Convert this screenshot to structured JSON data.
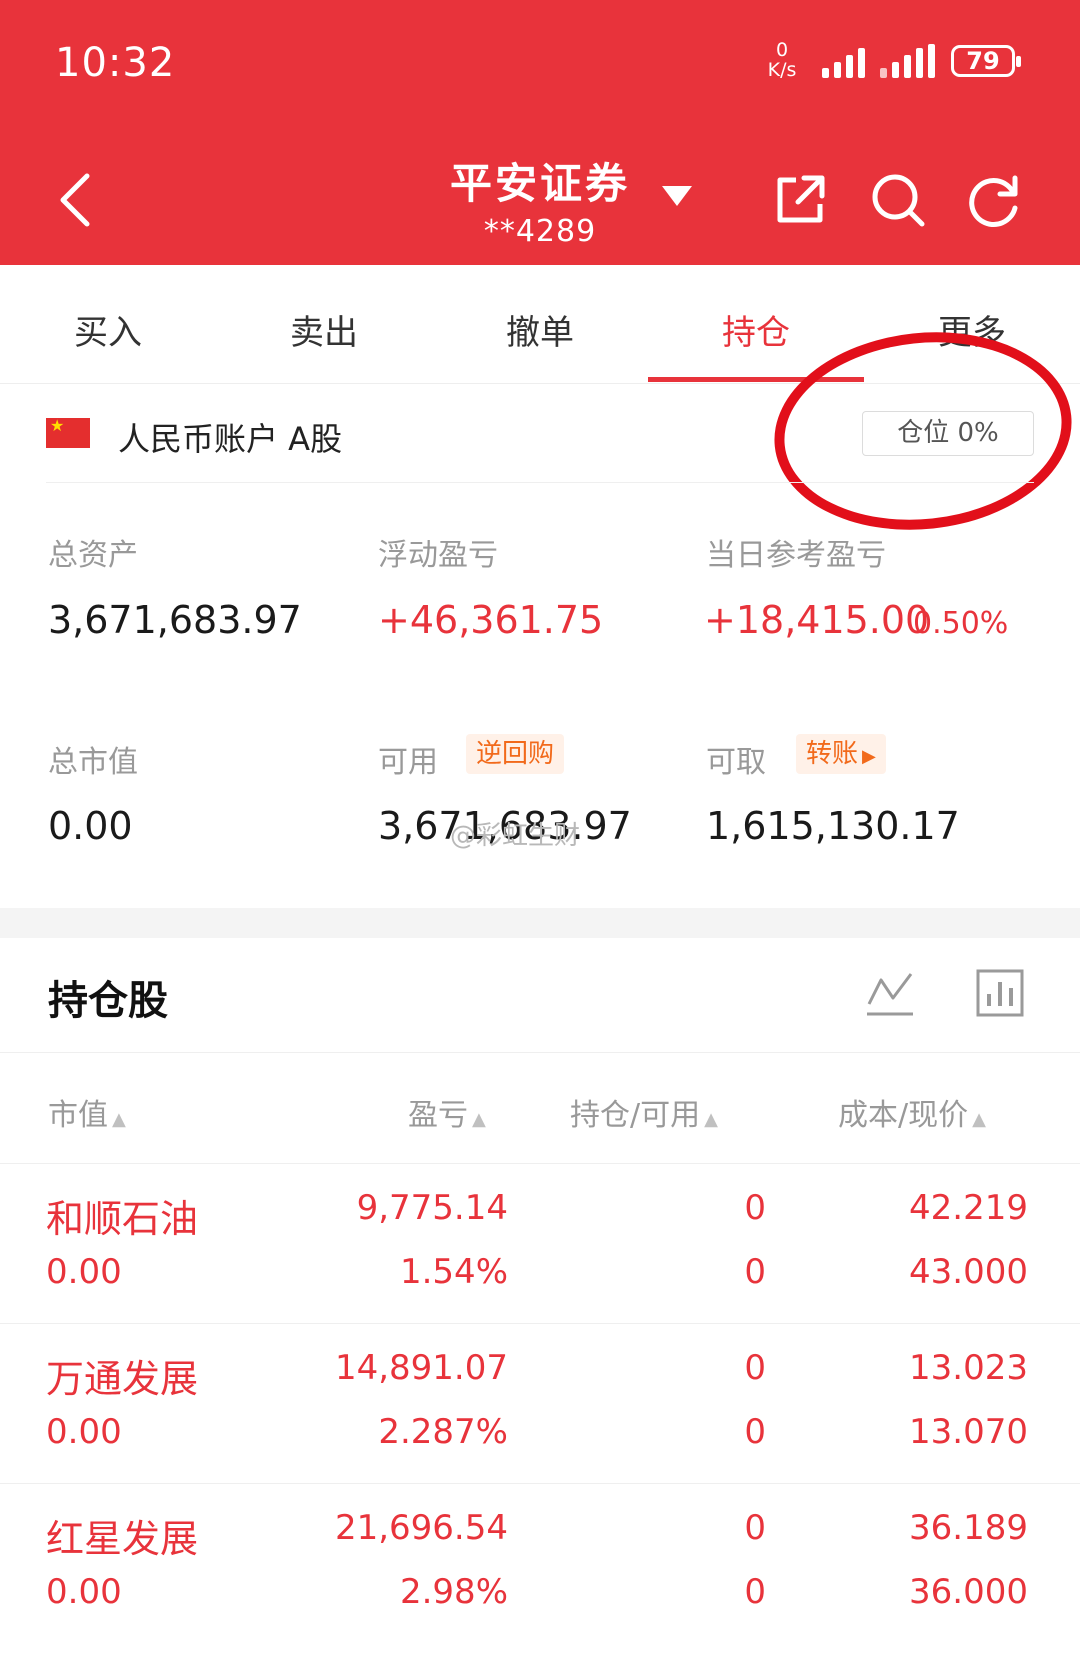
{
  "status_bar": {
    "time": "10:32",
    "net_speed_value": "0",
    "net_speed_unit": "K/s",
    "battery": "79"
  },
  "header": {
    "broker": "平安证券",
    "account": "**4289",
    "icons": [
      "back-icon",
      "dropdown-icon",
      "share-icon",
      "search-icon",
      "refresh-icon"
    ]
  },
  "tabs": [
    "买入",
    "卖出",
    "撤单",
    "持仓",
    "更多"
  ],
  "active_tab": 3,
  "account": {
    "name": "人民币账户 A股",
    "position_label": "仓位 0%"
  },
  "summary": {
    "total_assets": {
      "label": "总资产",
      "value": "3,671,683.97"
    },
    "floating_pl": {
      "label": "浮动盈亏",
      "value": "+46,361.75"
    },
    "today_pl": {
      "label": "当日参考盈亏",
      "value": "+18,415.00",
      "pct": "0.50%"
    },
    "market_value": {
      "label": "总市值",
      "value": "0.00"
    },
    "available": {
      "label": "可用",
      "tag": "逆回购",
      "value": "3,671,683.97"
    },
    "withdrawable": {
      "label": "可取",
      "tag": "转账",
      "value": "1,615,130.17"
    },
    "watermark": "@彩虹生财"
  },
  "holdings": {
    "title": "持仓股",
    "columns": [
      "市值",
      "盈亏",
      "持仓/可用",
      "成本/现价"
    ],
    "rows": [
      {
        "name": "和顺石油",
        "market_value": "0.00",
        "pl": "9,775.14",
        "pl_pct": "1.54%",
        "hold": "0",
        "avail": "0",
        "cost": "42.219",
        "price": "43.000"
      },
      {
        "name": "万通发展",
        "market_value": "0.00",
        "pl": "14,891.07",
        "pl_pct": "2.287%",
        "hold": "0",
        "avail": "0",
        "cost": "13.023",
        "price": "13.070"
      },
      {
        "name": "红星发展",
        "market_value": "0.00",
        "pl": "21,696.54",
        "pl_pct": "2.98%",
        "hold": "0",
        "avail": "0",
        "cost": "36.189",
        "price": "36.000"
      }
    ]
  },
  "colors": {
    "brand_red": "#e8333b",
    "orange_tag": "#f26a1b"
  }
}
